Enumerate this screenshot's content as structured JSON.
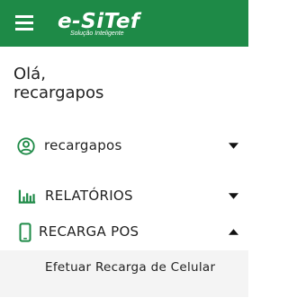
{
  "header": {
    "logo_text": "e-SiTef",
    "logo_tagline": "Solução Inteligente",
    "menu_icon": "hamburger-menu-icon",
    "background_color": "#1e8a47"
  },
  "greeting": {
    "salutation": "Olá,",
    "username": "recargapos"
  },
  "menu": {
    "user": {
      "label": "recargapos",
      "icon": "account-circle-icon",
      "expanded": false
    },
    "reports": {
      "label": "RELATÓRIOS",
      "icon": "bar-chart-icon",
      "expanded": false
    },
    "recarga_pos": {
      "label": "RECARGA POS",
      "icon": "smartphone-icon",
      "expanded": true,
      "subitems": [
        {
          "label": "Efetuar Recarga de Celular"
        }
      ]
    }
  },
  "colors": {
    "accent": "#1e8a47",
    "submenu_bg": "#f4f4f4"
  }
}
